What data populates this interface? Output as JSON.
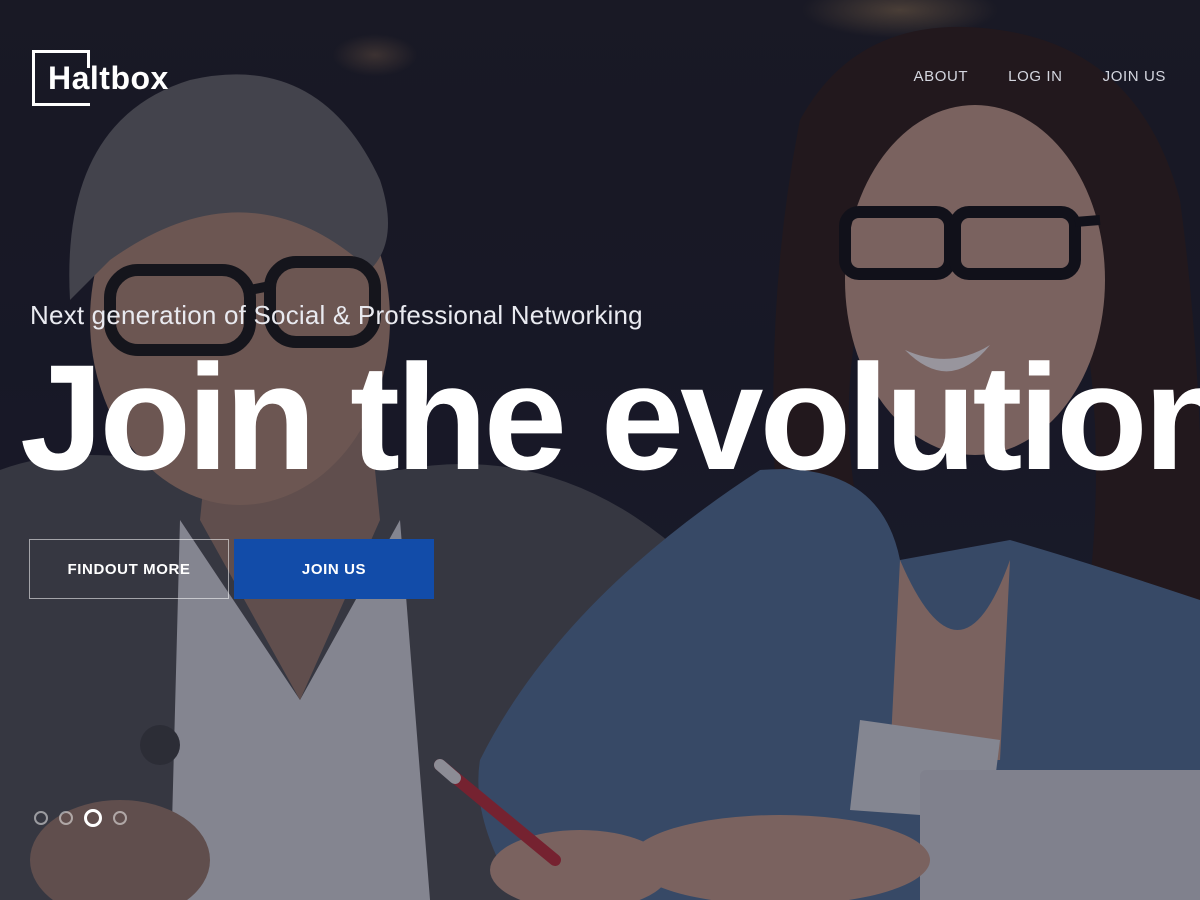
{
  "brand": {
    "name": "Haltbox"
  },
  "nav": {
    "items": [
      "ABOUT",
      "LOG IN",
      "JOIN US"
    ]
  },
  "hero": {
    "tagline": "Next generation of Social & Professional Networking",
    "headline": "Join the evolution",
    "buttons": {
      "secondary": "FINDOUT MORE",
      "primary": "JOIN US"
    },
    "slider": {
      "count": 4,
      "active_index": 2
    }
  },
  "colors": {
    "primary_button": "#124ca9",
    "text": "#ffffff",
    "overlay": "#141628"
  },
  "icons": {
    "slide_indicator": "circle-icon"
  }
}
